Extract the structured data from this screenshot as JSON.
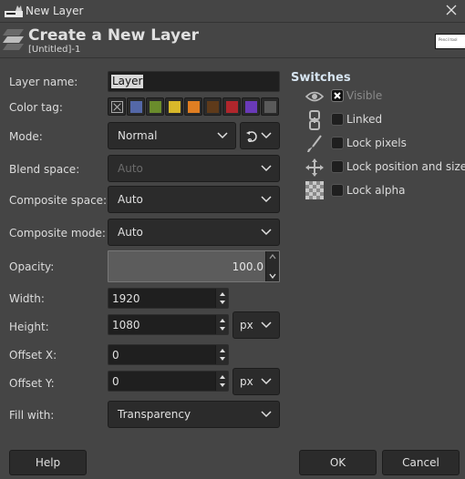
{
  "window": {
    "title": "New Layer",
    "icon": "gimp-wilber-icon",
    "close_icon": "close-icon"
  },
  "header": {
    "icon": "layers-icon",
    "title": "Create a New Layer",
    "subtitle": "[Untitled]-1",
    "thumbnail_text": "Pencil tool"
  },
  "form": {
    "layer_name": {
      "label": "Layer name:",
      "value": "Layer"
    },
    "color_tag": {
      "label": "Color tag:",
      "options": [
        {
          "name": "none",
          "color": ""
        },
        {
          "name": "blue",
          "color": "#5468a8"
        },
        {
          "name": "green",
          "color": "#6a8c2c"
        },
        {
          "name": "yellow",
          "color": "#d8b82a"
        },
        {
          "name": "orange",
          "color": "#e07e22"
        },
        {
          "name": "brown",
          "color": "#5e3a1a"
        },
        {
          "name": "red",
          "color": "#b0262c"
        },
        {
          "name": "violet",
          "color": "#6a3ab8"
        },
        {
          "name": "gray",
          "color": "#5a5a5a"
        }
      ],
      "selected": "none"
    },
    "mode": {
      "label": "Mode:",
      "value": "Normal",
      "reset_icon": "switch-mode-icon"
    },
    "blend_space": {
      "label": "Blend space:",
      "value": "Auto",
      "disabled": true
    },
    "composite_space": {
      "label": "Composite space:",
      "value": "Auto"
    },
    "composite_mode": {
      "label": "Composite mode:",
      "value": "Auto"
    },
    "opacity": {
      "label": "Opacity:",
      "value": "100.0"
    },
    "width": {
      "label": "Width:",
      "value": "1920"
    },
    "height": {
      "label": "Height:",
      "value": "1080"
    },
    "size_unit": "px",
    "offset_x": {
      "label": "Offset X:",
      "value": "0"
    },
    "offset_y": {
      "label": "Offset Y:",
      "value": "0"
    },
    "offset_unit": "px",
    "fill_with": {
      "label": "Fill with:",
      "value": "Transparency"
    }
  },
  "switches": {
    "title": "Switches",
    "items": [
      {
        "label": "Visible",
        "icon": "eye-icon",
        "checked": true
      },
      {
        "label": "Linked",
        "icon": "chain-icon",
        "checked": false
      },
      {
        "label": "Lock pixels",
        "icon": "paintbrush-icon",
        "checked": false
      },
      {
        "label": "Lock position and size",
        "icon": "move-icon",
        "checked": false
      },
      {
        "label": "Lock alpha",
        "icon": "checkerboard-icon",
        "checked": false
      }
    ]
  },
  "buttons": {
    "help": "Help",
    "ok": "OK",
    "cancel": "Cancel"
  }
}
